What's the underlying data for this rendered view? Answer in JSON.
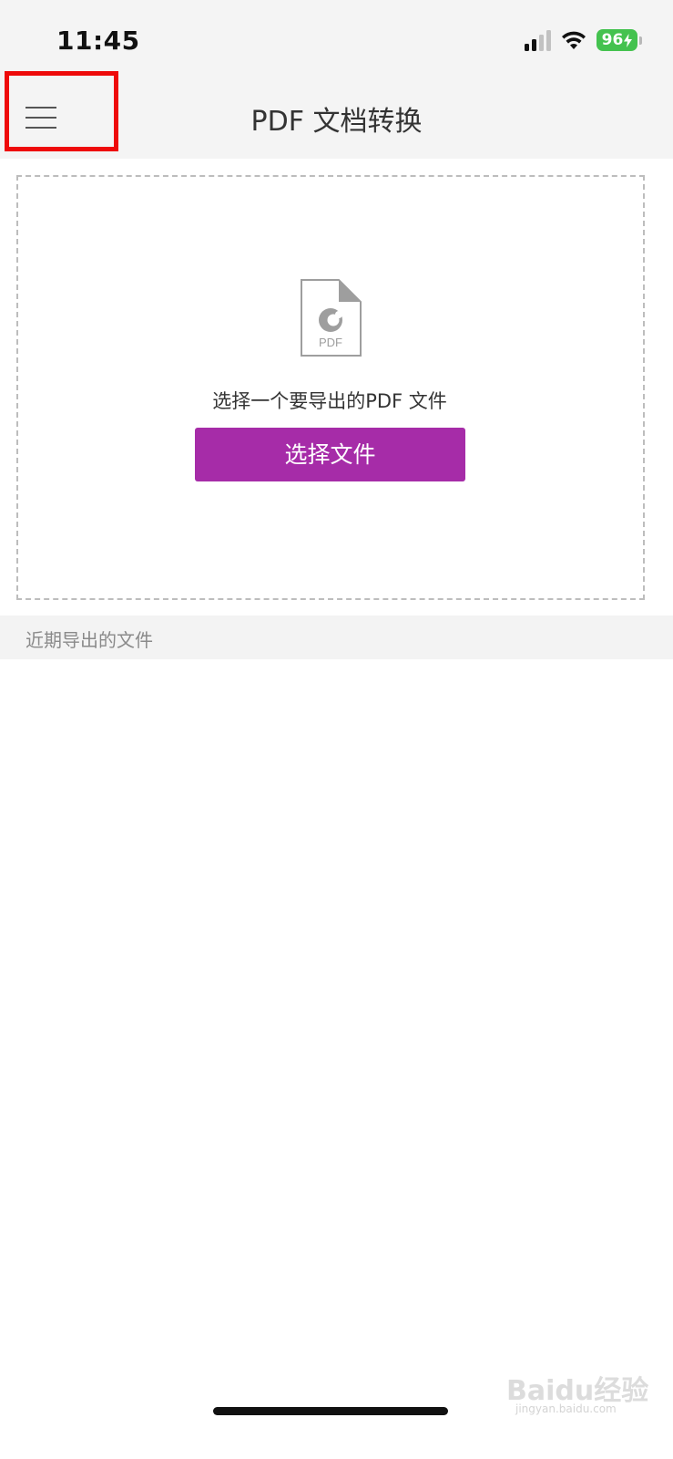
{
  "status_bar": {
    "time": "11:45",
    "battery": "96"
  },
  "header": {
    "title": "PDF 文档转换"
  },
  "upload": {
    "icon_label": "PDF",
    "prompt": "选择一个要导出的PDF 文件",
    "button_label": "选择文件"
  },
  "recent": {
    "header_label": "近期导出的文件"
  },
  "watermark": {
    "text": "Baidu经验",
    "sub": "jingyan.baidu.com"
  },
  "colors": {
    "accent": "#a62ca8",
    "highlight": "#ee0a0a",
    "battery": "#44c24f"
  }
}
